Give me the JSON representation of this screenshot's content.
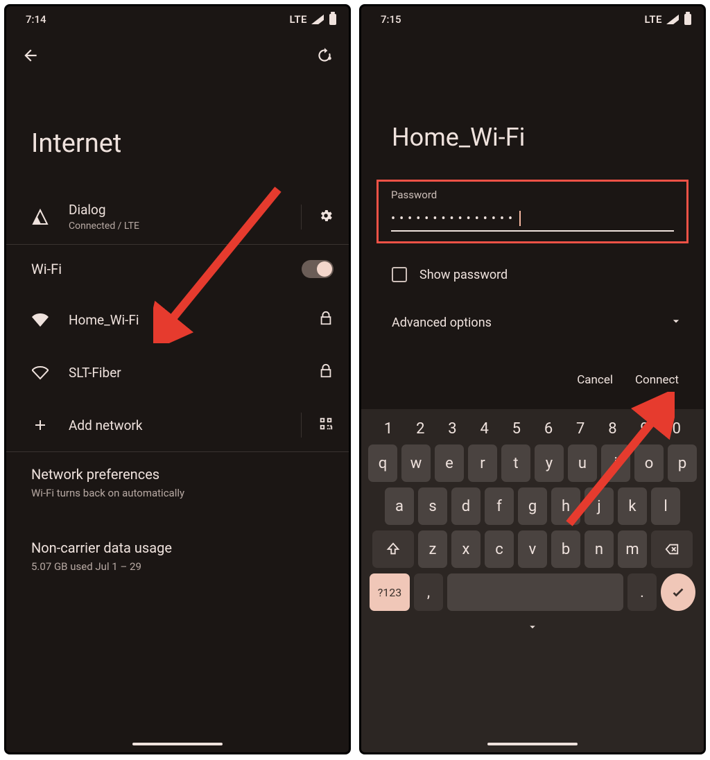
{
  "left": {
    "status": {
      "time": "7:14",
      "network": "LTE"
    },
    "page_title": "Internet",
    "carrier": {
      "name": "Dialog",
      "subtitle": "Connected / LTE"
    },
    "wifi_section": "Wi-Fi",
    "networks": [
      {
        "ssid": "Home_Wi-Fi"
      },
      {
        "ssid": "SLT-Fiber"
      }
    ],
    "add_network": "Add network",
    "prefs": {
      "title": "Network preferences",
      "subtitle": "Wi-Fi turns back on automatically"
    },
    "usage": {
      "title": "Non-carrier data usage",
      "subtitle": "5.07 GB used Jul 1 – 29"
    }
  },
  "right": {
    "status": {
      "time": "7:15",
      "network": "LTE"
    },
    "dialog_title": "Home_Wi-Fi",
    "password_label": "Password",
    "password_value": "•••••••••••••••",
    "show_password": "Show password",
    "advanced": "Advanced options",
    "actions": {
      "cancel": "Cancel",
      "connect": "Connect"
    },
    "keyboard": {
      "numbers": [
        "1",
        "2",
        "3",
        "4",
        "5",
        "6",
        "7",
        "8",
        "9",
        "0"
      ],
      "row1": [
        "q",
        "w",
        "e",
        "r",
        "t",
        "y",
        "u",
        "i",
        "o",
        "p"
      ],
      "row2": [
        "a",
        "s",
        "d",
        "f",
        "g",
        "h",
        "j",
        "k",
        "l"
      ],
      "row3": [
        "z",
        "x",
        "c",
        "v",
        "b",
        "n",
        "m"
      ],
      "symkey": "?123",
      "comma": ",",
      "period": "."
    }
  }
}
